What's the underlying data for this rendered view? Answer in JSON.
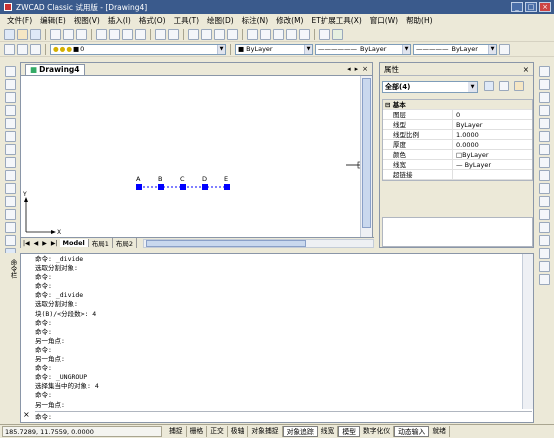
{
  "window": {
    "title": "ZWCAD Classic 试用版 - [Drawing4]",
    "min": "_",
    "max": "□",
    "close": "×"
  },
  "menu": [
    "文件(F)",
    "编辑(E)",
    "视图(V)",
    "插入(I)",
    "格式(O)",
    "工具(T)",
    "绘图(D)",
    "标注(N)",
    "修改(M)",
    "ET扩展工具(X)",
    "窗口(W)",
    "帮助(H)"
  ],
  "toolbar3": {
    "layer": "0",
    "color": "ByLayer",
    "linetype": "ByLayer",
    "lineweight": "ByLayer"
  },
  "drawing": {
    "tab_title": "Drawing4",
    "ctrls": [
      "◂",
      "▸",
      "×"
    ],
    "points": [
      {
        "label": "A",
        "x": 0
      },
      {
        "label": "B",
        "x": 1
      },
      {
        "label": "C",
        "x": 2
      },
      {
        "label": "D",
        "x": 3
      },
      {
        "label": "E",
        "x": 4
      }
    ],
    "axis_x": "X",
    "axis_y": "Y",
    "layout_tabs": [
      "Model",
      "布局1",
      "布局2"
    ],
    "nav": [
      "|◀",
      "◀",
      "▶",
      "▶|"
    ]
  },
  "properties": {
    "title": "属性",
    "close": "×",
    "selection": "全部(4)",
    "group": "基本",
    "rows": [
      {
        "k": "图层",
        "v": "0"
      },
      {
        "k": "线型",
        "v": "ByLayer"
      },
      {
        "k": "线型比例",
        "v": "1.0000"
      },
      {
        "k": "厚度",
        "v": "0.0000"
      },
      {
        "k": "颜色",
        "v": "□ByLayer"
      },
      {
        "k": "线宽",
        "v": "— ByLayer"
      },
      {
        "k": "超链接",
        "v": ""
      }
    ]
  },
  "command": {
    "label": "命令栏",
    "close": "×",
    "log": [
      "命令: _divide",
      "选取分割对象:",
      "命令:",
      "命令:",
      "命令: _divide",
      "选取分割对象:",
      "块(B)/<分段数>: 4",
      "命令:",
      "命令:",
      "另一角点:",
      "命令:",
      "另一角点:",
      "命令:",
      "命令: _UNGROUP",
      "选择集当中的对象: 4",
      "命令:",
      "另一角点:"
    ],
    "prompt": "命令:"
  },
  "status": {
    "coords": "185.7289,  11.7559,  0.0000",
    "buttons": [
      {
        "label": "捕捉",
        "on": false
      },
      {
        "label": "栅格",
        "on": false
      },
      {
        "label": "正交",
        "on": false
      },
      {
        "label": "极轴",
        "on": false
      },
      {
        "label": "对象捕捉",
        "on": false
      },
      {
        "label": "对象追踪",
        "on": true
      },
      {
        "label": "线宽",
        "on": false
      },
      {
        "label": "模型",
        "on": true
      },
      {
        "label": "数字化仪",
        "on": false
      },
      {
        "label": "动态输入",
        "on": true
      },
      {
        "label": "就绪",
        "on": false
      }
    ]
  },
  "colors": {
    "accent": "#0000ff",
    "titlebar": "#3a5a8c"
  }
}
